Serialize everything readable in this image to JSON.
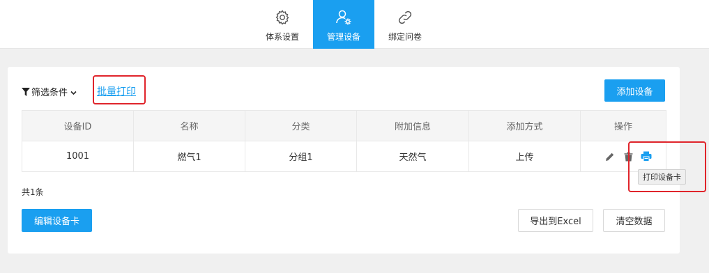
{
  "tabs": [
    {
      "label": "体系设置",
      "icon": "gear-icon"
    },
    {
      "label": "管理设备",
      "icon": "user-gear-icon"
    },
    {
      "label": "绑定问卷",
      "icon": "link-icon"
    }
  ],
  "toolbar": {
    "filter_label": "筛选条件",
    "batch_print_label": "批量打印",
    "add_device_label": "添加设备"
  },
  "table": {
    "columns": [
      "设备ID",
      "名称",
      "分类",
      "附加信息",
      "添加方式",
      "操作"
    ],
    "rows": [
      {
        "id": "1001",
        "name": "燃气1",
        "category": "分组1",
        "extra": "天然气",
        "method": "上传"
      }
    ]
  },
  "tooltip": "打印设备卡",
  "footer": {
    "total": "共1条",
    "edit_card_label": "编辑设备卡",
    "export_label": "导出到Excel",
    "clear_label": "清空数据"
  },
  "colors": {
    "accent": "#1a9ff0",
    "highlight_box": "#e0242b"
  }
}
